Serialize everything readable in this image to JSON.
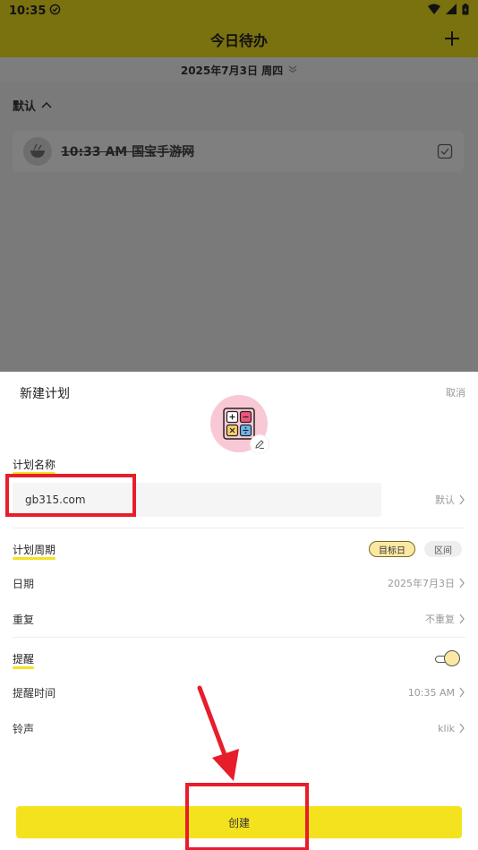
{
  "status": {
    "time": "10:35"
  },
  "app": {
    "title": "今日待办"
  },
  "date_header": {
    "text": "2025年7月3日 周四"
  },
  "group": {
    "label": "默认"
  },
  "task": {
    "title": "10:33 AM 国宝手游网"
  },
  "sheet": {
    "title": "新建计划",
    "cancel_label": "取消",
    "name_section": {
      "label": "计划名称",
      "input_value": "gb315.com",
      "category_value": "默认"
    },
    "period_section": {
      "label": "计划周期",
      "options": [
        {
          "label": "目标日",
          "selected": true
        },
        {
          "label": "区间",
          "selected": false
        }
      ]
    },
    "date_row": {
      "label": "日期",
      "value": "2025年7月3日"
    },
    "repeat_row": {
      "label": "重复",
      "value": "不重复"
    },
    "reminder_section": {
      "label": "提醒",
      "enabled": true
    },
    "reminder_time_row": {
      "label": "提醒时间",
      "value": "10:35 AM"
    },
    "ringtone_row": {
      "label": "铃声",
      "value": "klik"
    },
    "create_label": "创建"
  },
  "colors": {
    "accent": "#f4e21f",
    "highlight": "#e81d2b",
    "overlay": "rgba(0,0,0,0.5)"
  }
}
